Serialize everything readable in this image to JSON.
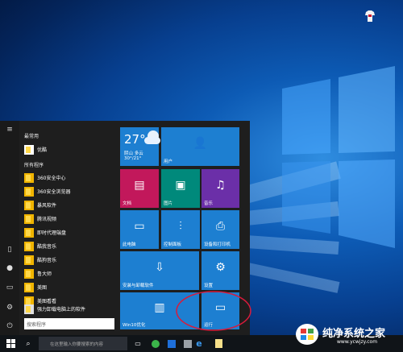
{
  "desktop": {
    "shirt_icon": "tshirt-icon"
  },
  "start_menu": {
    "sections": {
      "most_used": "最常用",
      "all_programs": "所有程序"
    },
    "most_used_apps": [
      {
        "label": "优酷"
      }
    ],
    "apps": [
      {
        "label": "360安全中心"
      },
      {
        "label": "360安全浏览器"
      },
      {
        "label": "暴风软件"
      },
      {
        "label": "腾讯视频"
      },
      {
        "label": "即时代理端盘"
      },
      {
        "label": "酷我音乐"
      },
      {
        "label": "酷狗音乐"
      },
      {
        "label": "鲁大师"
      },
      {
        "label": "美图"
      },
      {
        "label": "美图看看"
      },
      {
        "label": "强力卸载电脑上的软件"
      }
    ],
    "search_placeholder": "搜索程序"
  },
  "tiles": {
    "weather": {
      "temp": "27°",
      "condition": "阴山  多云",
      "range": "30°/21°"
    },
    "user": "用户",
    "documents": "文档",
    "pictures": "图片",
    "music": "音乐",
    "this_pc": "此电脑",
    "control_panel": "控制面板",
    "devices": "设备和打印机",
    "install_uninstall": "安装与卸载软件",
    "settings": "设置",
    "win10": "Win10优化",
    "run": "运行"
  },
  "taskbar": {
    "search_placeholder": "在这里输入你要搜索的内容"
  },
  "watermark": {
    "title": "纯净系统之家",
    "url": "www.ycwjzy.com"
  },
  "colors": {
    "tile_blue": "#1d7fd1",
    "tile_purple": "#6b2fa8",
    "accent_red": "#c8102e"
  }
}
